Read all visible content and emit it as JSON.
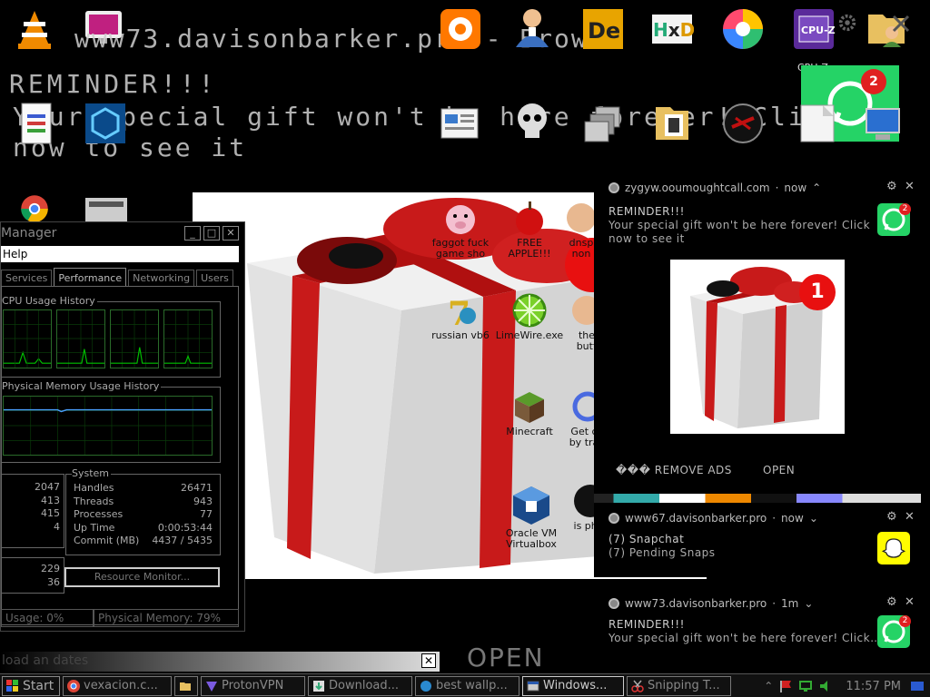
{
  "desktop": {
    "ghost_title": "www73.davisonbarker.pro - Brow",
    "ghost_reminder": "REMINDER!!!",
    "ghost_line1": "Your special gift won't be here forever! Click",
    "ghost_line2": "now to see it",
    "cpuz_label": "CPU-Z",
    "whatsapp_badge": "2",
    "gift_icons": [
      {
        "label": "faggot fuck game sho",
        "icon": "pig-icon"
      },
      {
        "label": "FREE APPLE!!!",
        "icon": "apple-icon"
      },
      {
        "label": "dnsp non",
        "icon": "face-icon"
      },
      {
        "label": "russian vb6",
        "icon": "vb6-icon"
      },
      {
        "label": "LimeWire.exe",
        "icon": "limewire-icon"
      },
      {
        "label": "the butt",
        "icon": "face-icon"
      },
      {
        "label": "Minecraft",
        "icon": "minecraft-icon"
      },
      {
        "label": "Get c by tra",
        "icon": "ring-icon"
      },
      {
        "label": "Oracle VM Virtualbox",
        "icon": "virtualbox-icon"
      },
      {
        "label": "is pho",
        "icon": "dark-circle-icon"
      }
    ]
  },
  "taskmgr": {
    "title": "Manager",
    "menu": "Help",
    "tabs": [
      "Services",
      "Performance",
      "Networking",
      "Users"
    ],
    "active_tab": "Performance",
    "cpu_history_label": "CPU Usage History",
    "memory_history_label": "Physical Memory Usage History",
    "system_label": "System",
    "left_values_a": [
      "2047",
      "413",
      "415",
      "4"
    ],
    "left_values_b": [
      "229",
      "36"
    ],
    "system_rows": [
      {
        "k": "Handles",
        "v": "26471"
      },
      {
        "k": "Threads",
        "v": "943"
      },
      {
        "k": "Processes",
        "v": "77"
      },
      {
        "k": "Up Time",
        "v": "0:00:53:44"
      },
      {
        "k": "Commit (MB)",
        "v": "4437 / 5435"
      }
    ],
    "resource_monitor_btn": "Resource Monitor...",
    "status_cpu": "Usage: 0%",
    "status_mem": "Physical Memory: 79%"
  },
  "notifications": [
    {
      "source": "zygyw.ooumoughtcall.com",
      "time": "now",
      "title": "REMINDER!!!",
      "body_line1": "Your special gift won't be here forever! Click",
      "body_line2": "now to see it",
      "badge": "2",
      "gift_badge": "1",
      "action1": "��� REMOVE ADS",
      "action2": "OPEN"
    },
    {
      "source": "www67.davisonbarker.pro",
      "time": "now",
      "title": "(7) Snapchat",
      "body": "(7) Pending Snaps"
    },
    {
      "source": "www73.davisonbarker.pro",
      "time": "1m",
      "title": "REMINDER!!!",
      "body": "Your special gift won't be here forever! Click…",
      "badge": "2"
    }
  ],
  "bottom": {
    "bar_text": "load an   dates",
    "open_label": "OPEN"
  },
  "taskbar": {
    "start": "Start",
    "items": [
      {
        "label": "vexacion.c...",
        "icon": "chrome-icon"
      },
      {
        "label": "",
        "icon": "folder-icon"
      },
      {
        "label": "ProtonVPN",
        "icon": "vpn-icon"
      },
      {
        "label": "Download...",
        "icon": "download-icon"
      },
      {
        "label": "best wallp...",
        "icon": "edge-icon"
      },
      {
        "label": "Windows...",
        "icon": "window-icon"
      },
      {
        "label": "Snipping T...",
        "icon": "scissors-icon"
      }
    ],
    "clock": "11:57 PM"
  },
  "colors": {
    "ribbon": "#c81a1a",
    "whatsapp": "#25d366",
    "snapchat": "#fffc00",
    "graph_green": "#00c000"
  }
}
